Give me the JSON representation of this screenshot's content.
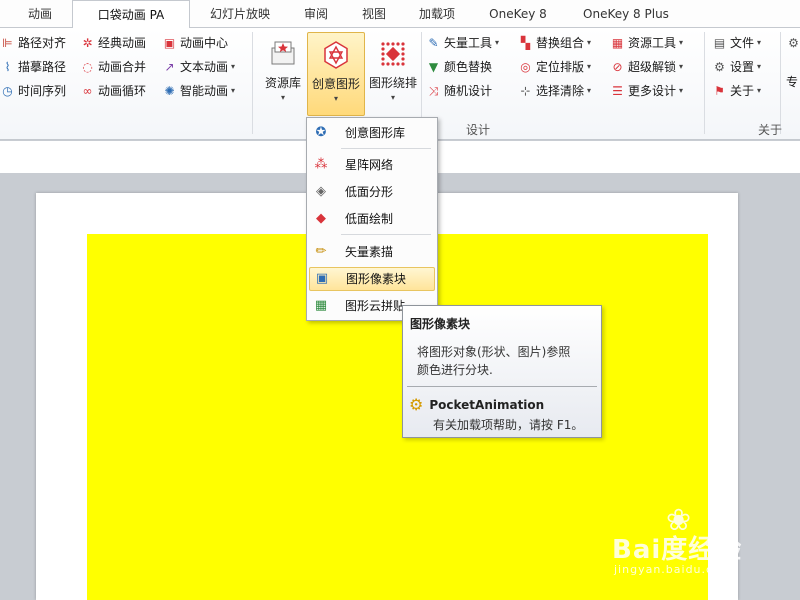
{
  "tabs": [
    {
      "label": "动画",
      "active": false
    },
    {
      "label": "口袋动画 PA",
      "active": true
    },
    {
      "label": "幻灯片放映",
      "active": false
    },
    {
      "label": "审阅",
      "active": false
    },
    {
      "label": "视图",
      "active": false
    },
    {
      "label": "加载项",
      "active": false
    },
    {
      "label": "OneKey 8",
      "active": false
    },
    {
      "label": "OneKey 8 Plus",
      "active": false
    }
  ],
  "ribbon": {
    "col1": [
      "路径对齐",
      "描摹路径",
      "时间序列"
    ],
    "col2": [
      "经典动画",
      "动画合并",
      "动画循环"
    ],
    "col3": [
      "动画中心",
      "文本动画",
      "智能动画"
    ],
    "big_buttons": [
      {
        "label": "资源库",
        "selected": false
      },
      {
        "label": "创意图形",
        "selected": true
      },
      {
        "label": "图形绕排",
        "selected": false
      }
    ],
    "col4": [
      "矢量工具",
      "颜色替换",
      "随机设计"
    ],
    "col5": [
      "替换组合",
      "定位排版",
      "选择清除"
    ],
    "col6": [
      "资源工具",
      "超级解锁",
      "更多设计"
    ],
    "col7": [
      "文件",
      "设置",
      "关于"
    ],
    "cut_label": "专",
    "group_design": "设计",
    "group_about": "关于"
  },
  "menu": {
    "items": [
      {
        "label": "创意图形库",
        "icon": "star-shield-icon",
        "highlighted": false
      },
      {
        "label": "星阵网络",
        "icon": "dot-grid-icon",
        "highlighted": false
      },
      {
        "label": "低面分形",
        "icon": "layers-outline-icon",
        "highlighted": false
      },
      {
        "label": "低面绘制",
        "icon": "layers-filled-icon",
        "highlighted": false
      },
      {
        "label": "矢量素描",
        "icon": "pencil-icon",
        "highlighted": false
      },
      {
        "label": "图形像素块",
        "icon": "pixel-block-icon",
        "highlighted": true
      },
      {
        "label": "图形云拼贴",
        "icon": "tile-grid-icon",
        "highlighted": false
      }
    ]
  },
  "tooltip": {
    "title": "图形像素块",
    "description_line1": "将图形对象(形状、图片)参照",
    "description_line2": "颜色进行分块.",
    "brand": "PocketAnimation",
    "help": "有关加载项帮助，请按 F1。"
  },
  "watermark": {
    "logo": "Bai度经验",
    "url": "jingyan.baidu.com"
  },
  "colors": {
    "slide_fill": "#ffff00",
    "highlight": "#ffe49a",
    "accent_red": "#d9343b"
  }
}
